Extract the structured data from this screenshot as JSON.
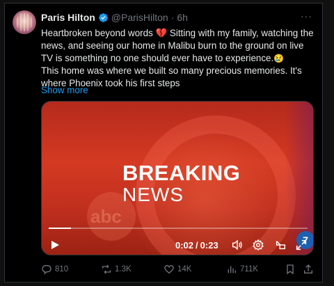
{
  "post": {
    "author_name": "Paris Hilton",
    "handle": "@ParisHilton",
    "separator": "·",
    "time": "6h",
    "more_label": "···",
    "text_part1": "Heartbroken beyond words ",
    "text_part2": " Sitting with my family, watching the news, and seeing our home in Malibu burn to the ground on live TV is something no one should ever have to experience.",
    "text_part3": "This home was where we built so many precious memories. It's where Phoenix took his first steps",
    "show_more": "Show more"
  },
  "video": {
    "headline_1": "BREAKING",
    "headline_2": "NEWS",
    "watermark": "abc",
    "corner_logo": "7",
    "current_time": "0:02",
    "time_separator": "/",
    "duration": "0:23",
    "progress_fraction": 0.087
  },
  "actions": {
    "replies": "810",
    "reposts": "1.3K",
    "likes": "14K",
    "views": "711K"
  },
  "colors": {
    "accent": "#1d9bf0",
    "muted": "#71767b",
    "text": "#e7e9ea",
    "background": "#000000",
    "video_red": "#c8321e"
  }
}
